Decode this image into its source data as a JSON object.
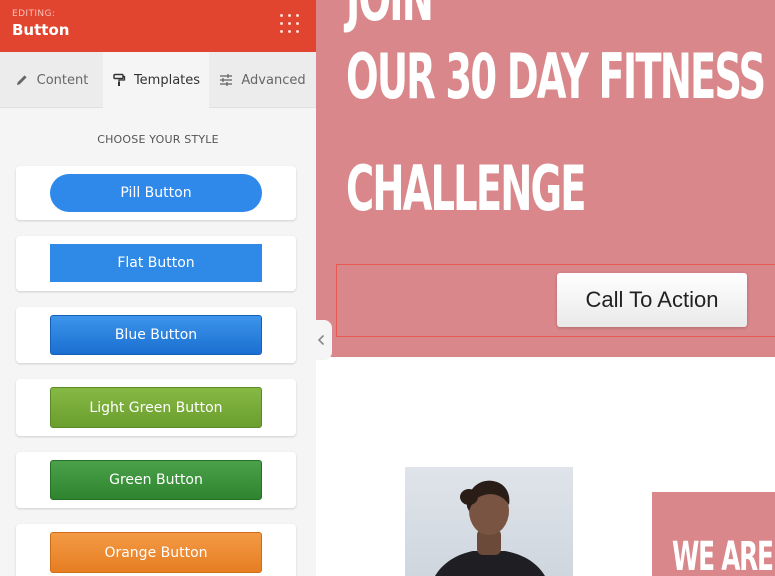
{
  "panel": {
    "editing_label": "EDITING:",
    "editing_title": "Button",
    "tabs": [
      {
        "label": "Content",
        "icon": "pencil-icon",
        "active": false
      },
      {
        "label": "Templates",
        "icon": "paint-roller-icon",
        "active": true
      },
      {
        "label": "Advanced",
        "icon": "sliders-icon",
        "active": false
      }
    ],
    "style_heading": "CHOOSE YOUR STYLE",
    "templates": [
      {
        "label": "Pill Button",
        "color": "#2f89eb"
      },
      {
        "label": "Flat Button",
        "color": "#2e8ae6"
      },
      {
        "label": "Blue Button",
        "color": "#1a6fd1"
      },
      {
        "label": "Light Green Button",
        "color": "#78ab38"
      },
      {
        "label": "Green Button",
        "color": "#3a913a"
      },
      {
        "label": "Orange Button",
        "color": "#ec8a30"
      }
    ]
  },
  "canvas": {
    "hero_lines": [
      "JOIN",
      "OUR 30 DAY FITNESS",
      "CHALLENGE"
    ],
    "cta_label": "Call To Action",
    "promo_text": "WE ARE",
    "colors": {
      "hero_bg": "#d9878a",
      "header_bg": "#e2452f",
      "selection_outline": "#e85a4f"
    }
  }
}
